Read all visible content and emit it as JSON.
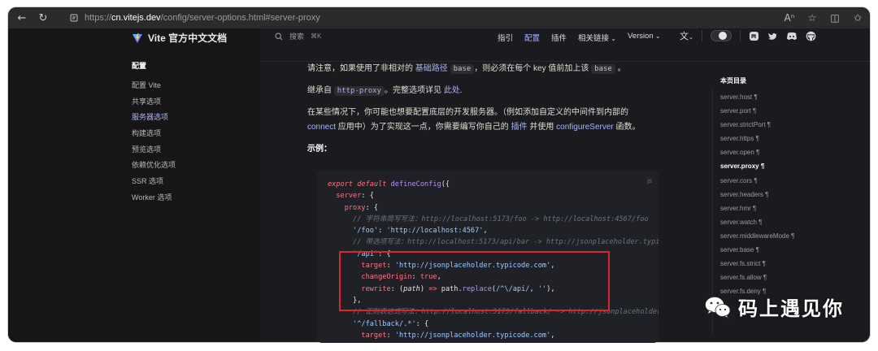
{
  "browser": {
    "url_prefix": "https://",
    "url_domain": "cn.vitejs.dev",
    "url_path": "/config/server-options.html#server-proxy"
  },
  "header": {
    "site_title": "Vite 官方中文文档",
    "search_label": "搜索",
    "search_shortcut": "⌘K",
    "nav": [
      {
        "label": "指引",
        "active": false
      },
      {
        "label": "配置",
        "active": true
      },
      {
        "label": "插件",
        "active": false
      },
      {
        "label": "相关链接",
        "active": false
      },
      {
        "label": "Version",
        "active": false
      }
    ]
  },
  "sidebar": {
    "group_title": "配置",
    "items": [
      {
        "label": "配置 Vite"
      },
      {
        "label": "共享选项"
      },
      {
        "label": "服务器选项"
      },
      {
        "label": "构建选项"
      },
      {
        "label": "预览选项"
      },
      {
        "label": "依赖优化选项"
      },
      {
        "label": "SSR 选项"
      },
      {
        "label": "Worker 选项"
      }
    ]
  },
  "content": {
    "p1_a": "请注意，如果使用了非相对的 ",
    "p1_link": "基础路径",
    "p1_code": "base",
    "p1_b": "，则必须在每个 key 值前加上该 ",
    "p1_code2": "base",
    "p1_c": "。",
    "p2_a": "继承自 ",
    "p2_code": "http-proxy",
    "p2_b": "。完整选项详见 ",
    "p2_link": "此处",
    "p2_c": ".",
    "p3_a": "在某些情况下，你可能也想要配置底层的开发服务器。（例如添加自定义的中间件到内部的",
    "p3_link1": "connect",
    "p3_b": " 应用中）为了实现这一点，你需要编写你自己的 ",
    "p3_link2": "插件",
    "p3_c": " 并使用 ",
    "p3_link3": "configureServer",
    "p3_d": " 函数。",
    "example_heading": "示例："
  },
  "code": {
    "lang": "js",
    "l1_export": "export",
    "l1_default": " default ",
    "l1_fn": "defineConfig",
    "l1_rest": "({",
    "l2": "server",
    "l3": "proxy",
    "c1": "// 字符串简写写法：http://localhost:5173/foo -> http://localhost:4567/foo",
    "l4_key": "'/foo'",
    "l4_val": "'http://localhost:4567'",
    "c2": "// 带选项写法：http://localhost:5173/api/bar -> http://jsonplaceholder.typi",
    "l5_key": "'/api'",
    "l6_key": "target",
    "l6_val": "'http://jsonplaceholder.typicode.com'",
    "l7_key": "changeOrigin",
    "l7_val": "true",
    "l8_key": "rewrite",
    "l8_param": "path",
    "l8_obj": "path",
    "l8_fn": "replace",
    "l8_regex": "/^\\/api/",
    "l8_str": "''",
    "l9": "},",
    "c3": "// 正则表达式写法：http://localhost:5173/fallback/ -> http://jsonplaceholder",
    "l10_key": "'^/fallback/.*'",
    "l11_key": "target",
    "l11_val": "'http://jsonplaceholder.typicode.com'"
  },
  "toc": {
    "title": "本页目录",
    "items": [
      {
        "label": "server.host ¶"
      },
      {
        "label": "server.port ¶"
      },
      {
        "label": "server.strictPort ¶"
      },
      {
        "label": "server.https ¶"
      },
      {
        "label": "server.open ¶"
      },
      {
        "label": "server.proxy ¶"
      },
      {
        "label": "server.cors ¶"
      },
      {
        "label": "server.headers ¶"
      },
      {
        "label": "server.hmr ¶"
      },
      {
        "label": "server.watch ¶"
      },
      {
        "label": "server.middlewareMode ¶"
      },
      {
        "label": "server.base ¶"
      },
      {
        "label": "server.fs.strict ¶"
      },
      {
        "label": "server.fs.allow ¶"
      },
      {
        "label": "server.fs.deny ¶"
      }
    ]
  },
  "watermark": {
    "text": "码上遇见你"
  },
  "colors": {
    "accent": "#a8b1ff",
    "background": "#1b1b1f",
    "highlight_box": "#d9262b"
  }
}
